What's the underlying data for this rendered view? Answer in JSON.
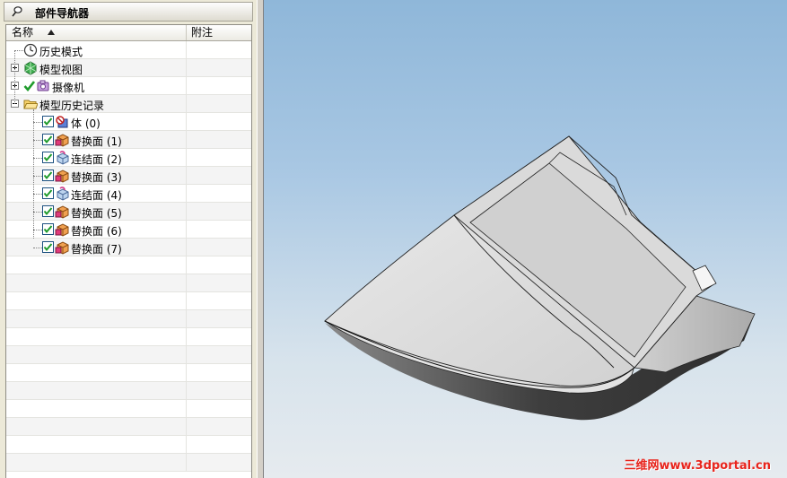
{
  "navigator": {
    "title": "部件导航器",
    "columns": {
      "name": "名称",
      "note": "附注"
    },
    "nodes": [
      {
        "label": "历史模式",
        "icon": "clock-icon",
        "expander": "none",
        "level": 1,
        "checked": false
      },
      {
        "label": "模型视图",
        "icon": "model-view-icon",
        "expander": "plus",
        "level": 1,
        "checked": false
      },
      {
        "label": "摄像机",
        "icon": "camera-icon",
        "expander": "plus",
        "level": 1,
        "checked": true
      },
      {
        "label": "模型历史记录",
        "icon": "folder-open-icon",
        "expander": "minus",
        "level": 1,
        "checked": false
      },
      {
        "label": "体 (0)",
        "icon": "body-feature-icon",
        "expander": "none",
        "level": 2,
        "checked": true
      },
      {
        "label": "替换面 (1)",
        "icon": "replace-face-icon",
        "expander": "none",
        "level": 2,
        "checked": true
      },
      {
        "label": "连结面 (2)",
        "icon": "join-face-icon",
        "expander": "none",
        "level": 2,
        "checked": true
      },
      {
        "label": "替换面 (3)",
        "icon": "replace-face-icon",
        "expander": "none",
        "level": 2,
        "checked": true
      },
      {
        "label": "连结面 (4)",
        "icon": "join-face-icon",
        "expander": "none",
        "level": 2,
        "checked": true
      },
      {
        "label": "替换面 (5)",
        "icon": "replace-face-icon",
        "expander": "none",
        "level": 2,
        "checked": true
      },
      {
        "label": "替换面 (6)",
        "icon": "replace-face-icon",
        "expander": "none",
        "level": 2,
        "checked": true
      },
      {
        "label": "替换面 (7)",
        "icon": "replace-face-icon",
        "expander": "none",
        "level": 2,
        "checked": true
      }
    ]
  },
  "viewport": {
    "watermark": "三维网www.3dportal.cn",
    "background_top": "#8fb7d9",
    "background_bottom": "#e6ebef"
  },
  "colors": {
    "check_green": "#1f9b2c",
    "model_face": "#d6d6d6",
    "model_side": "#4a4a4a",
    "watermark": "#e8241c"
  }
}
